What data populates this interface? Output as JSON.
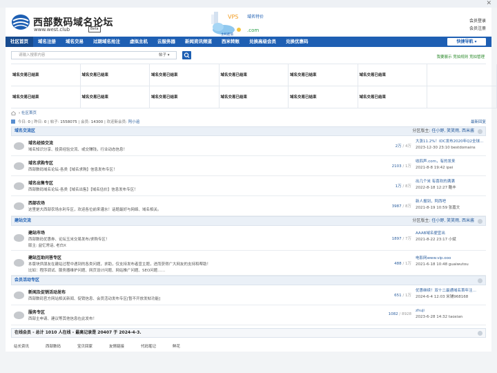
{
  "topbar": {
    "close_icon": "close-icon"
  },
  "header": {
    "site_title": "西部数码域名论坛",
    "site_url": "www.west.club",
    "beta": "Beta",
    "banner": {
      "vps": "VPS",
      "domain_special": "域名特价",
      "host": "主机超值",
      "com": ".com"
    },
    "links": [
      "会员登录",
      "会员注册"
    ]
  },
  "nav": {
    "items": [
      "社区首页",
      "域名注册",
      "域名交易",
      "过期域名抢注",
      "虚拟主机",
      "云服务器",
      "新闻资讯频道",
      "西米转账",
      "兑换高级会员",
      "兑换优惠码"
    ],
    "quick_nav": "快捷导航 ▾"
  },
  "search": {
    "placeholder": "请输入搜索内容",
    "type": "帖子 ▾",
    "right_links": "我要展示 竞拍规则 竞拍管理"
  },
  "ads": {
    "cells": [
      "域名交易已结束",
      "域名交易已结束",
      "域名交易已结束",
      "域名交易已结束",
      "域名交易已结束",
      "域名交易已结束",
      "",
      "域名交易已结束",
      "域名交易已结束",
      "域名交易已结束",
      "域名交易已结束",
      "域名交易已结束",
      "域名交易已结束",
      ""
    ]
  },
  "breadcrumb": {
    "label": "社区首页"
  },
  "stats": {
    "today_label": "今日:",
    "today": "0",
    "yesterday_label": "昨日:",
    "yesterday": "0",
    "posts_label": "帖子:",
    "posts": "1558075",
    "members_label": "会员:",
    "members": "14300",
    "welcome": "欢迎新会员:",
    "new_member": "阿小追",
    "latest": "最新回复"
  },
  "sections": [
    {
      "title": "域名交流区",
      "mods_label": "分区版主:",
      "mods": "任小野, 笑笑雨, 西米酱",
      "forums": [
        {
          "name": "域名经验交流",
          "desc": "域名知识分享、投资经验交流、或交赚钱，行业动态信息！",
          "desc2": "",
          "topics": "2万",
          "posts": "4万",
          "last_title": "大涨11.2%！IDC发布2020年Q2全球…",
          "last_time": "2023-12-30 23:10 bestdomains"
        },
        {
          "name": "域名求购专区",
          "desc": "西部数码域名论坛-各类【域名求购】信息发布专区！",
          "desc2": "",
          "topics": "2103",
          "posts": "1万",
          "last_title": "收四声.com，有的发来",
          "last_time": "2021-8-8 19:42 ipei"
        },
        {
          "name": "域名出售专区",
          "desc": "西部数码域名论坛-各类【域名出售】【域名估价】信息发布专区！",
          "desc2": "",
          "topics": "1万",
          "posts": "8万",
          "last_title": "出几个米 有喜欢的满满",
          "last_time": "2022-8-18 12:27 酷丰"
        },
        {
          "name": "西部农场",
          "desc": "这里是大西部农场水利专区，欢迎各位前来灌水！话题最好与网络、域名相关。",
          "desc2": "",
          "topics": "3987",
          "posts": "8万",
          "last_title": "新人报到，阿西吧",
          "last_time": "2021-8-19 10:59 张嘉文"
        }
      ]
    },
    {
      "title": "建站交流",
      "mods_label": "分区版主:",
      "mods": "任小野, 笑笑雨, 西米酱",
      "forums": [
        {
          "name": "建站市场",
          "desc": "西部数码优惠券、论坛玉米交易发布/求购专区！",
          "desc2": "版主: 益忆常话, 老白X",
          "topics": "1897",
          "posts": "7万",
          "last_title": "AAAB域名便宜出",
          "last_time": "2021-8-22 23:17 小斌"
        },
        {
          "name": "建站互助问答专区",
          "desc": "本版块供朋友在建站过程中遇到的各类问题，求助，仅支持发布者宣主题，进而获得广大网友的支持和帮助！",
          "desc2": "比如：程序调试、服务器维护问题、网页设计问题、网站推广问题、SEO问题……",
          "topics": "488",
          "posts": "1万",
          "last_title": "电影网www.vip.ooo",
          "last_time": "2021-6-18 10:48 guaiwutou"
        }
      ]
    },
    {
      "title": "会员活动专区",
      "mods_label": "",
      "mods": "",
      "forums": [
        {
          "name": "新闻及促销活动发布",
          "desc": "西部数码官方网站相关新闻、促销信息、会员活动发布专区[暂不开放发帖功能]",
          "desc2": "",
          "topics": "651",
          "posts": "1万",
          "last_title": "优惠继续！双十二最通域名首年注…",
          "last_time": "2024-6-4 12:03 米铺968168"
        },
        {
          "name": "服务专区",
          "desc": "西部主申请、建议等其他信息在此发布！",
          "desc2": "",
          "topics": "1082",
          "posts": "8928",
          "last_title": "zhuji",
          "last_time": "2023-6-28 14:32 taoxian"
        }
      ]
    }
  ],
  "online": {
    "text": "在线会员 - 总计 1010 人在线 - 最高记录是 20407 于 2024-4-3."
  },
  "friend_links": [
    "站长资讯",
    "西部数码",
    "宝贝回家",
    "友情链接",
    "代码笔记",
    "鲜花"
  ]
}
